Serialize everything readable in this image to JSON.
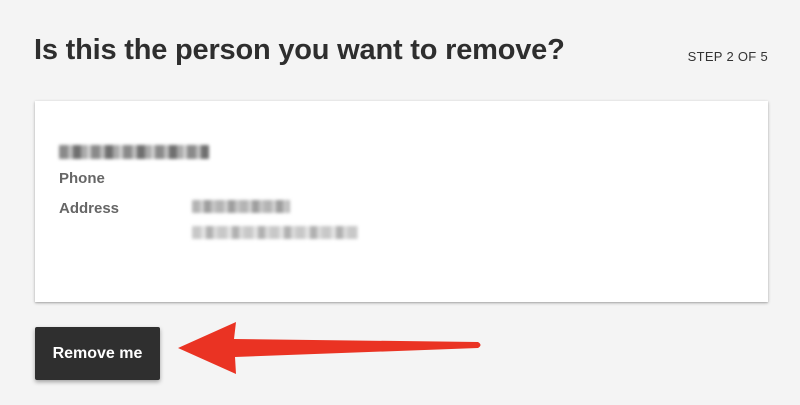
{
  "header": {
    "title": "Is this the person you want to remove?",
    "step": "STEP 2 OF 5"
  },
  "record": {
    "labels": {
      "phone": "Phone",
      "address": "Address"
    }
  },
  "actions": {
    "remove_label": "Remove me"
  },
  "colors": {
    "background": "#f4f4f4",
    "card": "#ffffff",
    "button": "#2f2f2f",
    "annotation_arrow": "#ea3323"
  }
}
